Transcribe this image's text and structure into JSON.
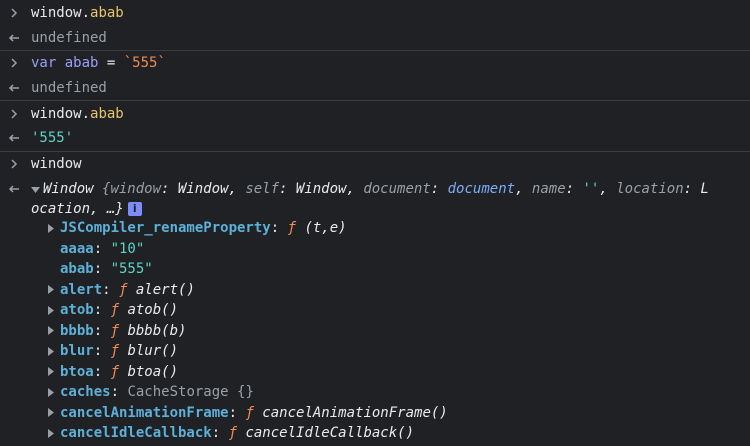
{
  "entries": [
    {
      "input": {
        "obj": "window",
        "dot": ".",
        "prop": "abab"
      },
      "result": "undefined"
    },
    {
      "input": {
        "kw": "var",
        "name": "abab",
        "eq": " = ",
        "str": "`555`"
      },
      "result": "undefined"
    },
    {
      "input": {
        "obj": "window",
        "dot": ".",
        "prop": "abab"
      },
      "result": "'555'"
    },
    {
      "input": {
        "obj": "window"
      }
    }
  ],
  "window_preview": {
    "class_name": "Window",
    "open_brace": " {",
    "k_window": "window",
    "v_window": "Window",
    "k_self": "self",
    "v_self": "Window",
    "k_document": "document",
    "v_document": "document",
    "k_name": "name",
    "v_name": "''",
    "k_location": "location",
    "v_location_part1": "L",
    "v_location_part2": "ocation",
    "tail": ", …}",
    "info_badge": "i"
  },
  "properties": [
    {
      "key": "JSCompiler_renameProperty",
      "f": "ƒ",
      "value": " (t,e)",
      "expandable": true,
      "kind": "fn"
    },
    {
      "key": "aaaa",
      "value": "\"10\"",
      "expandable": false,
      "kind": "str"
    },
    {
      "key": "abab",
      "value": "\"555\"",
      "expandable": false,
      "kind": "str"
    },
    {
      "key": "alert",
      "f": "ƒ",
      "value": " alert()",
      "expandable": true,
      "kind": "fn"
    },
    {
      "key": "atob",
      "f": "ƒ",
      "value": " atob()",
      "expandable": true,
      "kind": "fn"
    },
    {
      "key": "bbbb",
      "f": "ƒ",
      "value": " bbbb(b)",
      "expandable": true,
      "kind": "fn"
    },
    {
      "key": "blur",
      "f": "ƒ",
      "value": " blur()",
      "expandable": true,
      "kind": "fn"
    },
    {
      "key": "btoa",
      "f": "ƒ",
      "value": " btoa()",
      "expandable": true,
      "kind": "fn"
    },
    {
      "key": "caches",
      "value": "CacheStorage {}",
      "expandable": true,
      "kind": "obj"
    },
    {
      "key": "cancelAnimationFrame",
      "f": "ƒ",
      "value": " cancelAnimationFrame()",
      "expandable": true,
      "kind": "fn"
    },
    {
      "key": "cancelIdleCallback",
      "f": "ƒ",
      "value": " cancelIdleCallback()",
      "expandable": true,
      "kind": "fn"
    }
  ],
  "icons": {
    "prompt": "chevron-right-icon",
    "result": "return-arrow-icon",
    "expand": "triangle-right-icon",
    "collapse": "triangle-down-icon"
  },
  "colors": {
    "background": "#202124",
    "separator": "#3c3c3c",
    "property_key": "#5db0d7",
    "function_f": "#f28b54",
    "string_value": "#5cd5c7",
    "undefined": "#9aa0a6"
  }
}
